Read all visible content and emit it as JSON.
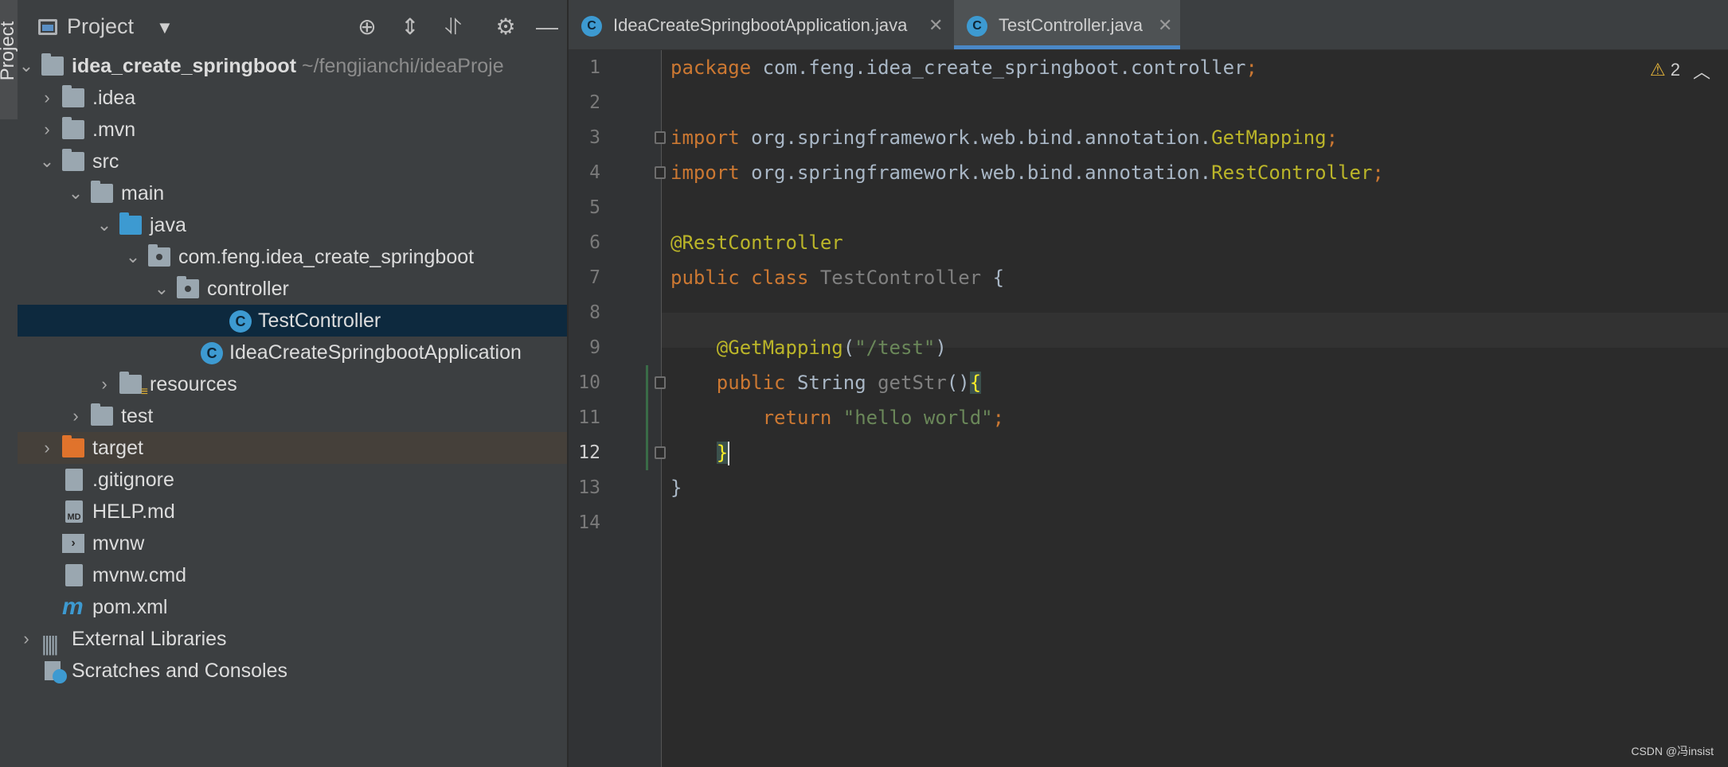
{
  "stripe": {
    "label": "Project"
  },
  "panel": {
    "title": "Project"
  },
  "tree": {
    "root_name": "idea_create_springboot",
    "root_path": "~/fengjianchi/ideaProje",
    "idea": ".idea",
    "mvn": ".mvn",
    "src": "src",
    "main": "main",
    "java": "java",
    "package": "com.feng.idea_create_springboot",
    "controller": "controller",
    "test_controller": "TestController",
    "application": "IdeaCreateSpringbootApplication",
    "resources": "resources",
    "test": "test",
    "target": "target",
    "gitignore": ".gitignore",
    "help": "HELP.md",
    "mvnw": "mvnw",
    "mvnw_cmd": "mvnw.cmd",
    "pom": "pom.xml",
    "external_libraries": "External Libraries",
    "scratches": "Scratches and Consoles"
  },
  "tabs": [
    {
      "label": "IdeaCreateSpringbootApplication.java"
    },
    {
      "label": "TestController.java"
    }
  ],
  "editor": {
    "line_numbers": [
      "1",
      "2",
      "3",
      "4",
      "5",
      "6",
      "7",
      "8",
      "9",
      "10",
      "11",
      "12",
      "13",
      "14"
    ],
    "current_line": "12",
    "warnings_count": "2",
    "code": {
      "l1_kw": "package",
      "l1_rest": " com.feng.idea_create_springboot.controller",
      "l3_kw": "import",
      "l3_pkg": " org.springframework.web.bind.annotation.",
      "l3_cls": "GetMapping",
      "l4_kw": "import",
      "l4_pkg": " org.springframework.web.bind.annotation.",
      "l4_cls": "RestController",
      "l6_ann": "@RestController",
      "l7_kw": "public class",
      "l7_name": "TestController",
      "l7_brace": " {",
      "l9_ann": "@GetMapping",
      "l9_str": "\"/test\"",
      "l10_kw": "public",
      "l10_type": " String ",
      "l10_name": "getStr",
      "l11_kw": "return",
      "l11_str": "\"hello world\"",
      "l13": "}"
    }
  },
  "watermark": "CSDN @冯insist"
}
